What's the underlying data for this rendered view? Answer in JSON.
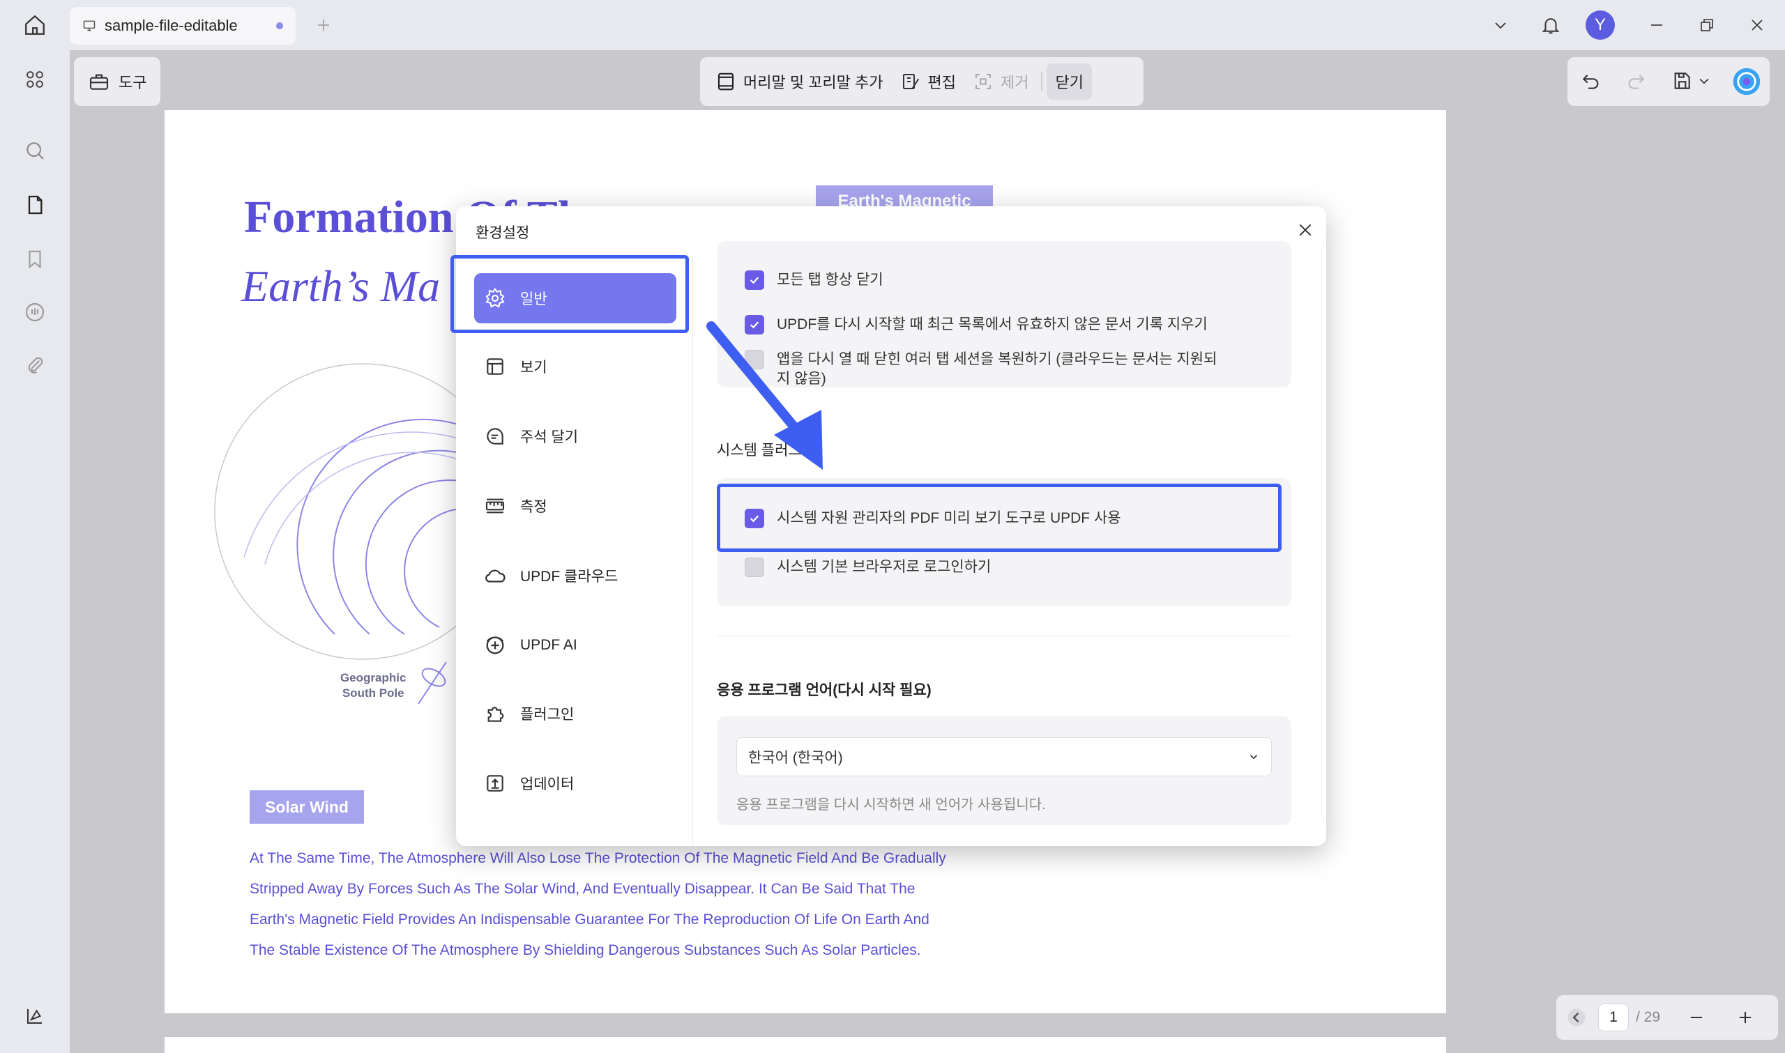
{
  "titlebar": {
    "tab_title": "sample-file-editable",
    "avatar_initial": "Y"
  },
  "toolbar": {
    "tools_label": "도구",
    "header_footer_label": "머리말 및 꼬리말 추가",
    "edit_label": "편집",
    "remove_label": "제거",
    "close_label": "닫기"
  },
  "pdf": {
    "title_line1": "Formation Of Th",
    "title_line2": "Earth’s Ma",
    "tag_top": "Earth's Magnetic",
    "tag_solar_wind": "Solar Wind",
    "diagram_label_line1": "Geographic",
    "diagram_label_line2": "South Pole",
    "body_lines": [
      "At The Same Time, The Atmosphere Will Also Lose The Protection Of The Magnetic Field And Be Gradually",
      "Stripped Away By Forces Such As The Solar Wind, And Eventually Disappear. It Can Be Said That The",
      "Earth's Magnetic Field Provides An Indispensable Guarantee For The Reproduction Of Life On Earth And",
      "The Stable Existence Of The Atmosphere By Shielding Dangerous Substances Such As Solar Particles."
    ]
  },
  "pager": {
    "current": "1",
    "total": "/ 29"
  },
  "dialog": {
    "title": "환경설정",
    "sidebar": [
      {
        "label": "일반",
        "icon": "gear-icon"
      },
      {
        "label": "보기",
        "icon": "layout-icon"
      },
      {
        "label": "주석 달기",
        "icon": "comment-icon"
      },
      {
        "label": "측정",
        "icon": "ruler-icon"
      },
      {
        "label": "UPDF 클라우드",
        "icon": "cloud-icon"
      },
      {
        "label": "UPDF AI",
        "icon": "ai-icon"
      },
      {
        "label": "플러그인",
        "icon": "puzzle-icon"
      },
      {
        "label": "업데이터",
        "icon": "update-icon"
      }
    ],
    "general": {
      "options": [
        {
          "label": "모든 탭 항상 닫기",
          "checked": true
        },
        {
          "label": "UPDF를 다시 시작할 때 최근 목록에서 유효하지 않은 문서 기록 지우기",
          "checked": true
        },
        {
          "label": "앱을 다시 열 때 닫힌 여러 탭 세션을 복원하기 (클라우드는 문서는 지원되지 않음)",
          "checked": false
        }
      ]
    },
    "system": {
      "heading": "시스템 플러그인",
      "options": [
        {
          "label": "시스템 자원 관리자의 PDF 미리 보기 도구로 UPDF 사용",
          "checked": true
        },
        {
          "label": "시스템 기본 브라우저로 로그인하기",
          "checked": false
        }
      ]
    },
    "language": {
      "heading": "응용 프로그램 언어(다시 시작 필요)",
      "selected": "한국어 (한국어)",
      "hint": "응용 프로그램을 다시 시작하면 새 언어가 사용됩니다."
    }
  },
  "colors": {
    "accent": "#7577ee",
    "checkbox": "#6a5be6",
    "highlight": "#3d5ef0",
    "pdf_text": "#5a4fd6"
  }
}
